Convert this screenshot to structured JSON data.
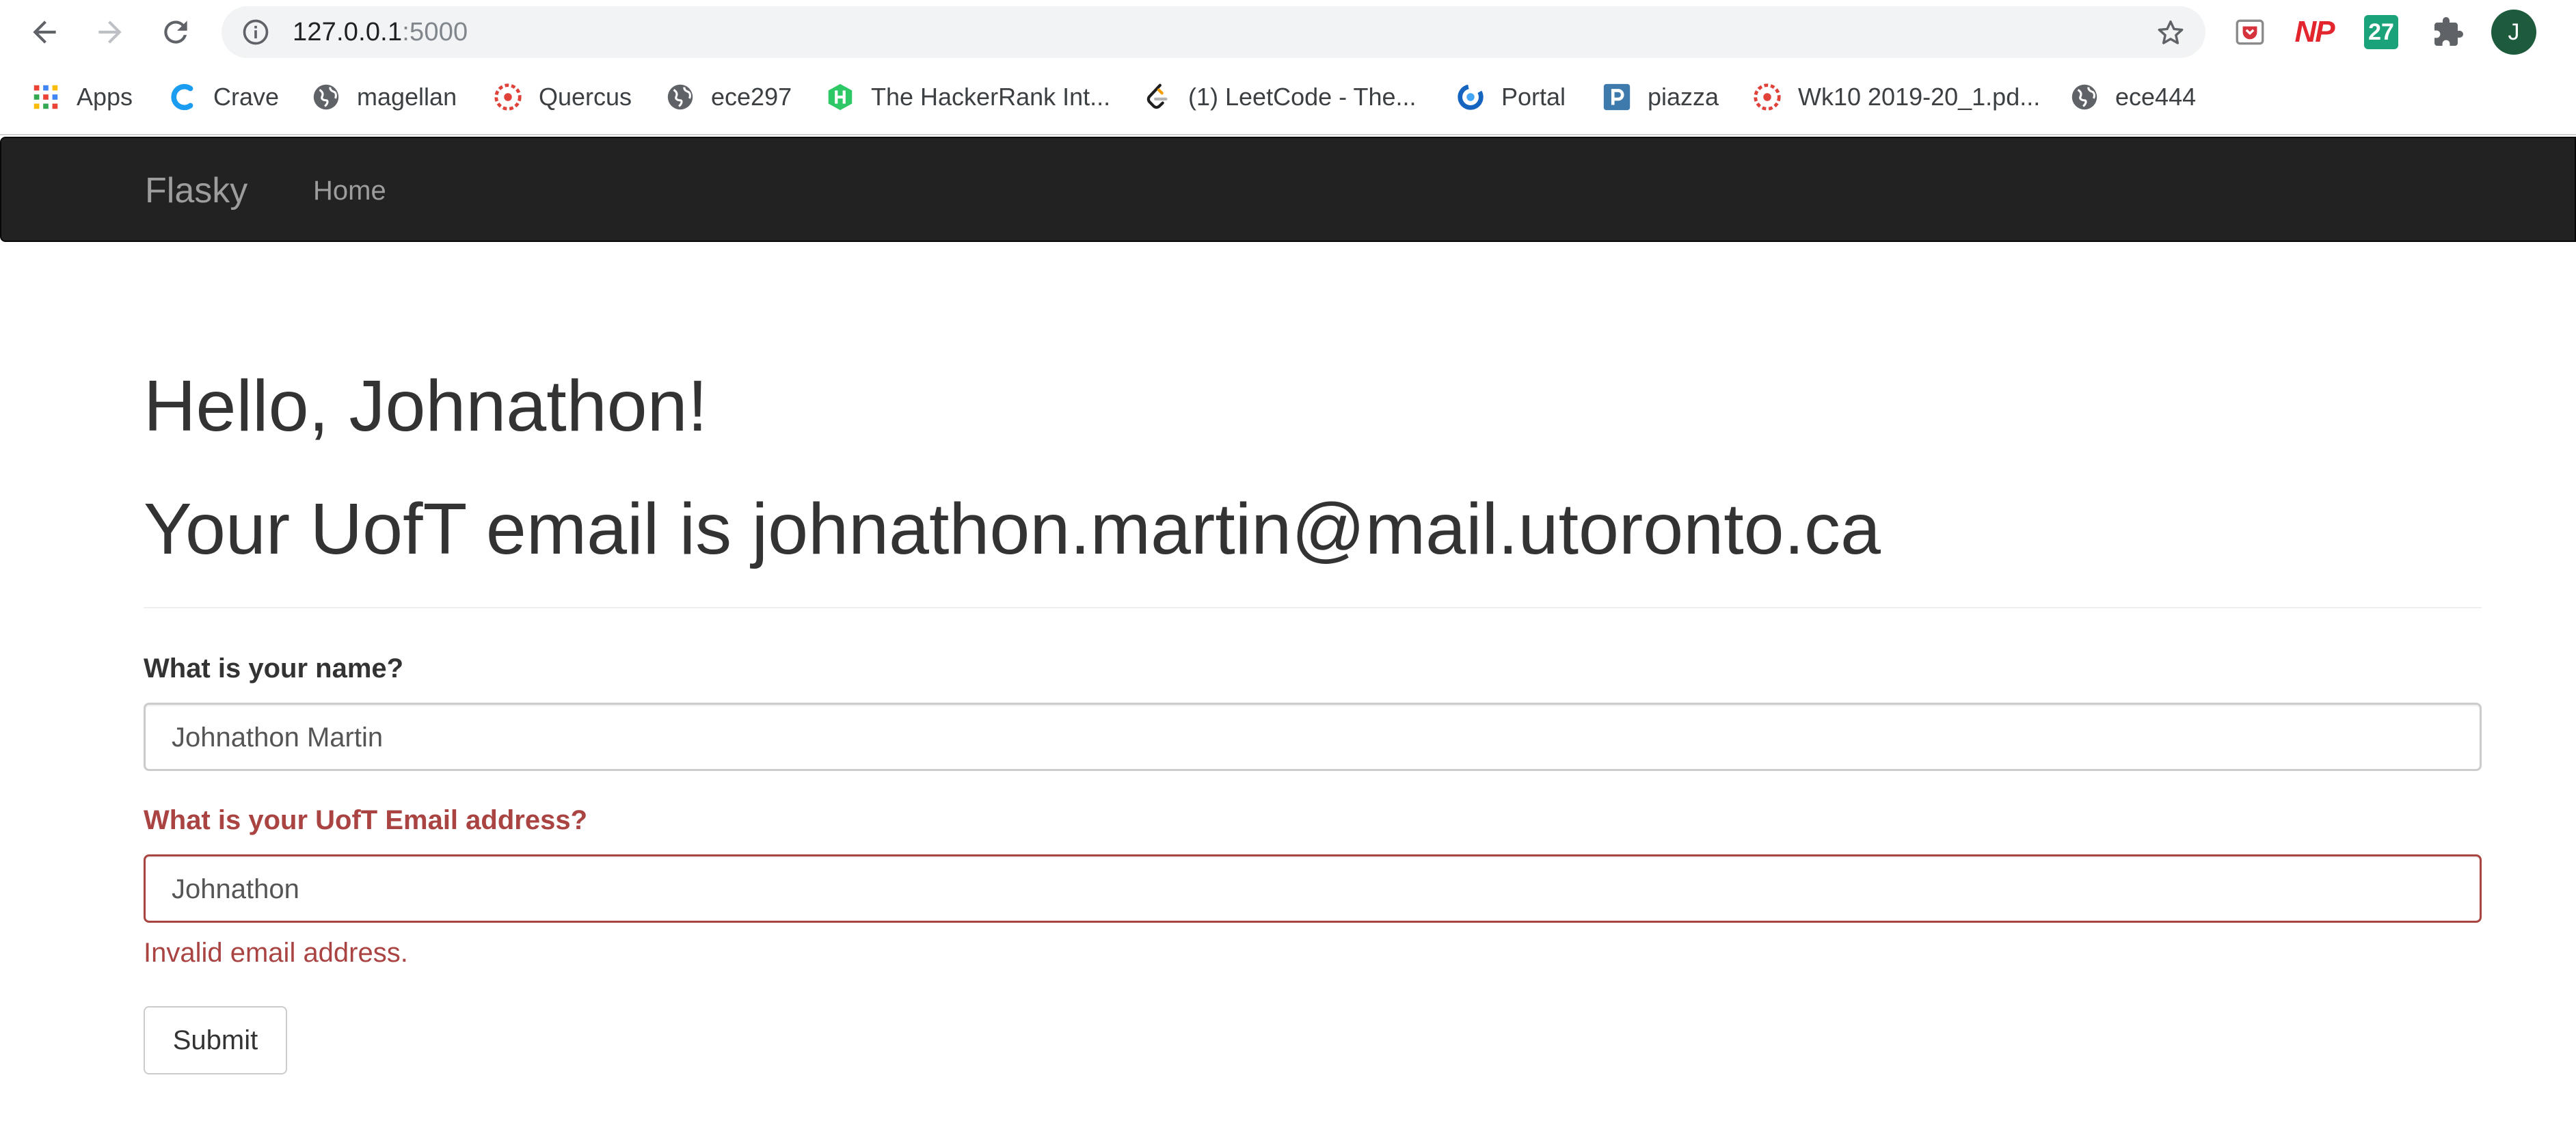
{
  "browser": {
    "url_host": "127.0.0.1",
    "url_port": ":5000",
    "avatar_letter": "J",
    "extensions": {
      "np_label": "NP",
      "cal_label": "27"
    },
    "bookmarks": [
      {
        "label": "Apps",
        "icon": "apps-grid-icon"
      },
      {
        "label": "Crave",
        "icon": "crave-icon"
      },
      {
        "label": "magellan",
        "icon": "globe-icon"
      },
      {
        "label": "Quercus",
        "icon": "quercus-icon"
      },
      {
        "label": "ece297",
        "icon": "globe-icon"
      },
      {
        "label": "The HackerRank Int...",
        "icon": "hackerrank-icon"
      },
      {
        "label": "(1) LeetCode - The...",
        "icon": "leetcode-icon"
      },
      {
        "label": "Portal",
        "icon": "portal-icon"
      },
      {
        "label": "piazza",
        "icon": "piazza-icon"
      },
      {
        "label": "Wk10 2019-20_1.pd...",
        "icon": "quercus-icon"
      },
      {
        "label": "ece444",
        "icon": "globe-icon"
      }
    ]
  },
  "navbar": {
    "brand": "Flasky",
    "home": "Home"
  },
  "page": {
    "greeting": "Hello, Johnathon!",
    "email_line": "Your UofT email is johnathon.martin@mail.utoronto.ca"
  },
  "form": {
    "name_label": "What is your name?",
    "name_value": "Johnathon Martin",
    "email_label": "What is your UofT Email address?",
    "email_value": "Johnathon",
    "email_error": "Invalid email address.",
    "submit_label": "Submit"
  },
  "colors": {
    "navbar_bg": "#222222",
    "error": "#a94442",
    "text": "#333333"
  }
}
